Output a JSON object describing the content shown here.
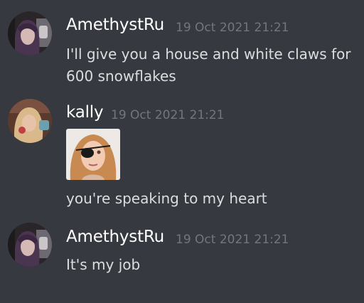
{
  "messages": [
    {
      "author": "AmethystRu",
      "timestamp": "19 Oct 2021 21:21",
      "avatar_icon": "user-avatar-purple-hair",
      "content": "I'll give you a house and white claws for 600 snowflakes"
    },
    {
      "author": "kally",
      "timestamp": "19 Oct 2021 21:21",
      "avatar_icon": "user-avatar-blonde",
      "attachment_icon": "image-attachment-eyepatch-selfie",
      "content": "you're speaking to my heart"
    },
    {
      "author": "AmethystRu",
      "timestamp": "19 Oct 2021 21:21",
      "avatar_icon": "user-avatar-purple-hair",
      "content": "It's my job"
    }
  ],
  "colors": {
    "background": "#36393f",
    "author": "#ffffff",
    "timestamp": "#72767d",
    "text": "#dcddde"
  }
}
